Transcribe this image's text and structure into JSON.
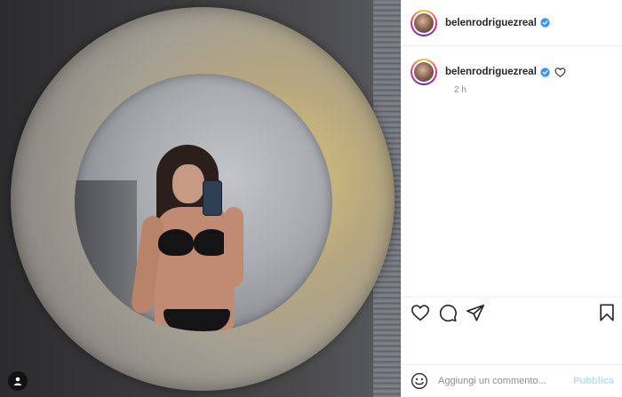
{
  "post": {
    "username": "belenrodriguezreal",
    "verified": true,
    "time_ago": "2 h"
  },
  "photo": {
    "tag_icon": "person-icon"
  },
  "actions": {
    "like_icon": "heart-icon",
    "comment_icon": "comment-icon",
    "share_icon": "share-icon",
    "save_icon": "bookmark-icon"
  },
  "comment_box": {
    "placeholder": "Aggiungi un commento...",
    "publish_label": "Pubblica"
  },
  "colors": {
    "verified_blue": "#3897f0",
    "publish_disabled": "#b2dffc"
  }
}
